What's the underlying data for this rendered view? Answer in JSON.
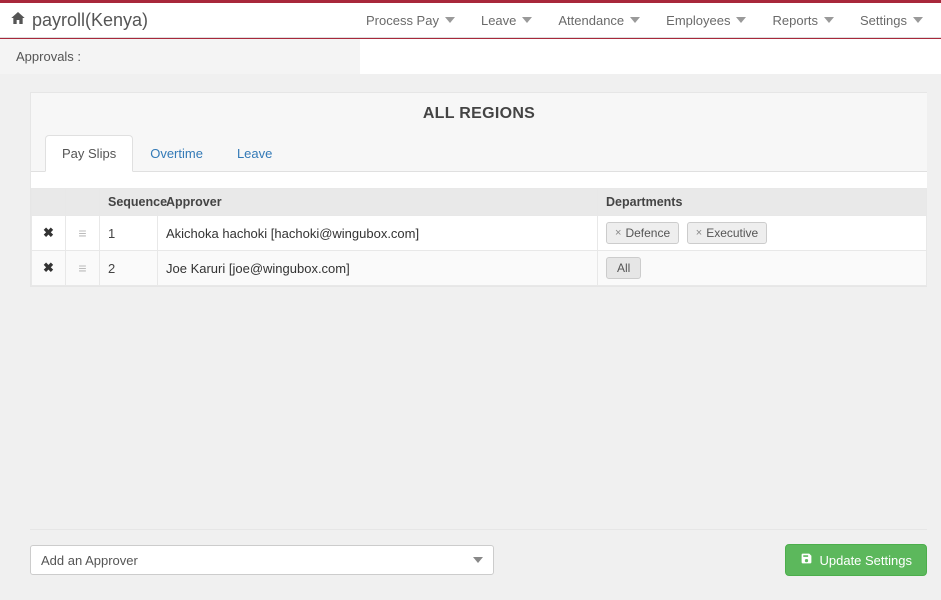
{
  "header": {
    "app_title": "payroll(Kenya)",
    "menus": [
      {
        "label": "Process Pay"
      },
      {
        "label": "Leave"
      },
      {
        "label": "Attendance"
      },
      {
        "label": "Employees"
      },
      {
        "label": "Reports"
      },
      {
        "label": "Settings"
      }
    ]
  },
  "breadcrumb": "Approvals :",
  "panel": {
    "title": "ALL REGIONS",
    "tabs": [
      {
        "label": "Pay Slips",
        "active": true
      },
      {
        "label": "Overtime",
        "active": false
      },
      {
        "label": "Leave",
        "active": false
      }
    ],
    "columns": {
      "sequence": "Sequence",
      "approver": "Approver",
      "departments": "Departments"
    },
    "rows": [
      {
        "sequence": "1",
        "approver": "Akichoka hachoki [hachoki@wingubox.com]",
        "departments": [
          "Defence",
          "Executive"
        ]
      },
      {
        "sequence": "2",
        "approver": "Joe Karuri [joe@wingubox.com]",
        "departments_all_label": "All"
      }
    ]
  },
  "footer": {
    "dropdown_label": "Add an Approver",
    "update_button": "Update Settings"
  }
}
